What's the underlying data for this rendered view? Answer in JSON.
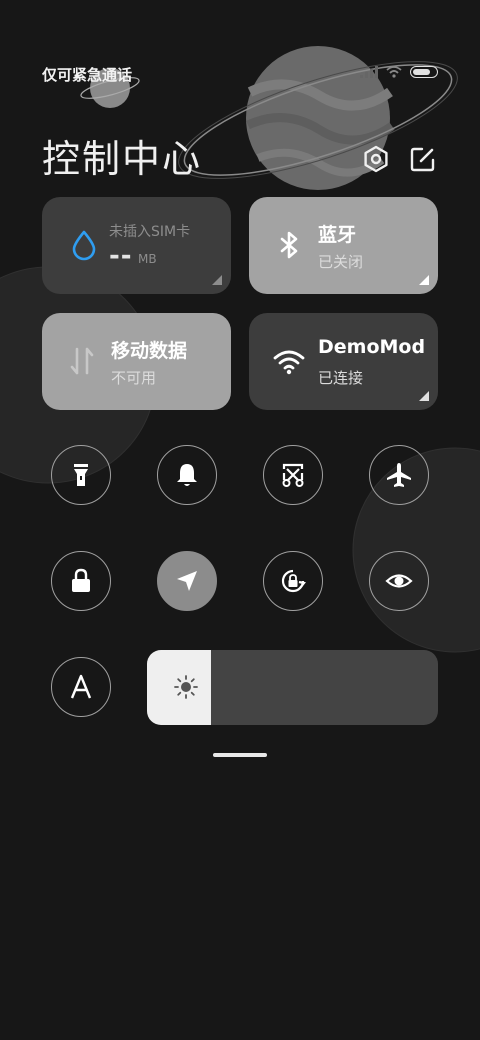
{
  "status_bar": {
    "text": "仅可紧急通话",
    "signal_icon": "signal-icon",
    "wifi_icon": "wifi-icon",
    "battery_icon": "battery-icon"
  },
  "header": {
    "title": "控制中心",
    "settings_icon": "gear-icon",
    "edit_icon": "edit-icon"
  },
  "tiles": {
    "data_usage": {
      "label": "未插入SIM卡",
      "value": "--",
      "unit": "MB",
      "icon": "water-drop-icon"
    },
    "bluetooth": {
      "label": "蓝牙",
      "status": "已关闭",
      "icon": "bluetooth-icon"
    },
    "mobile_data": {
      "label": "移动数据",
      "status": "不可用",
      "icon": "data-arrows-icon"
    },
    "wifi": {
      "label": "DemoMode",
      "status": "已连接",
      "icon": "wifi-icon"
    }
  },
  "toggles": [
    {
      "name": "flashlight",
      "icon": "flashlight-icon",
      "active": false
    },
    {
      "name": "silent",
      "icon": "bell-icon",
      "active": false
    },
    {
      "name": "screenshot",
      "icon": "scissors-icon",
      "active": false
    },
    {
      "name": "airplane",
      "icon": "airplane-icon",
      "active": false
    },
    {
      "name": "lock",
      "icon": "lock-icon",
      "active": false
    },
    {
      "name": "location",
      "icon": "location-arrow-icon",
      "active": true
    },
    {
      "name": "rotation-lock",
      "icon": "rotation-lock-icon",
      "active": false
    },
    {
      "name": "reading-mode",
      "icon": "eye-icon",
      "active": false
    },
    {
      "name": "auto-brightness",
      "icon": "letter-a-icon",
      "active": false
    }
  ],
  "brightness": {
    "level": 0.22,
    "icon": "sun-icon"
  },
  "colors": {
    "background": "#171717",
    "tile_dark": "#3d3d3d",
    "tile_light": "#a3a3a3",
    "accent_blue": "#2f9df0"
  }
}
